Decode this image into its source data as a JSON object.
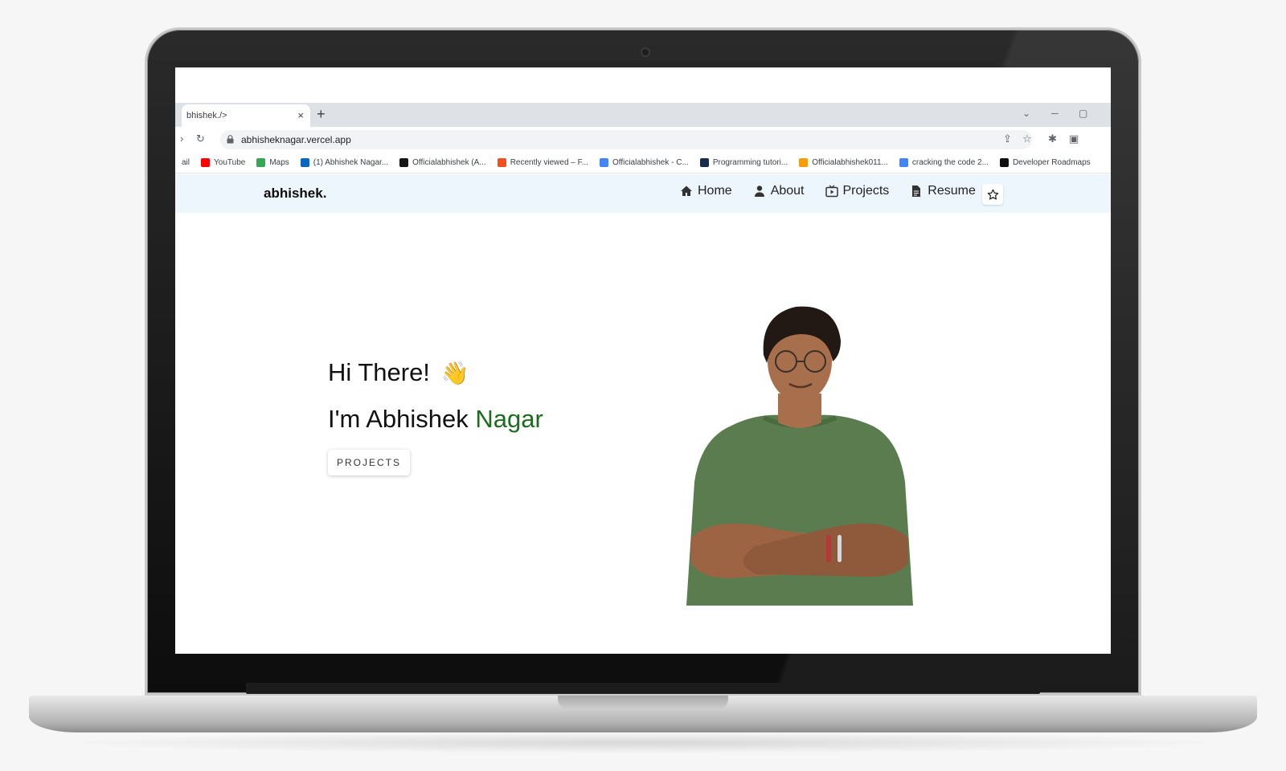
{
  "browser": {
    "tab_title": "bhishek./>",
    "tab_close": "×",
    "new_tab": "+",
    "url": "abhisheknagar.vercel.app",
    "window_controls": {
      "dropdown": "⌄",
      "minimize": "─",
      "maximize": "▢"
    },
    "bookmarks": [
      {
        "label": "ail",
        "icon": "gmail-icon",
        "color": "#ffffff"
      },
      {
        "label": "YouTube",
        "icon": "youtube-icon",
        "color": "#ff0000"
      },
      {
        "label": "Maps",
        "icon": "maps-icon",
        "color": "#34a853"
      },
      {
        "label": "(1) Abhishek Nagar...",
        "icon": "linkedin-icon",
        "color": "#0a66c2"
      },
      {
        "label": "Officialabhishek (A...",
        "icon": "github-icon",
        "color": "#181717"
      },
      {
        "label": "Recently viewed – F...",
        "icon": "figma-icon",
        "color": "#f24e1e"
      },
      {
        "label": "Officialabhishek - C...",
        "icon": "chart-icon",
        "color": "#4285f4"
      },
      {
        "label": "Programming tutori...",
        "icon": "hashnode-icon",
        "color": "#1a2b4c"
      },
      {
        "label": "Officialabhishek011...",
        "icon": "codepen-icon",
        "color": "#f59e0b"
      },
      {
        "label": "cracking the code 2...",
        "icon": "docs-icon",
        "color": "#4285f4"
      },
      {
        "label": "Developer Roadmaps",
        "icon": "roadmap-icon",
        "color": "#111111"
      }
    ]
  },
  "site": {
    "brand": "abhishek.",
    "nav": [
      {
        "label": "Home",
        "icon": "home-icon"
      },
      {
        "label": "About",
        "icon": "user-icon"
      },
      {
        "label": "Projects",
        "icon": "tv-icon"
      },
      {
        "label": "Resume",
        "icon": "document-icon"
      }
    ],
    "hero": {
      "greeting": "Hi There!",
      "wave_emoji": "👋",
      "intro_prefix": "I'm Abhishek",
      "intro_highlight": "Nagar",
      "cta_label": "PROJECTS"
    },
    "colors": {
      "accent": "#1d6b1d",
      "nav_bg": "#eef6fd",
      "shirt": "#5b7c4e"
    }
  }
}
